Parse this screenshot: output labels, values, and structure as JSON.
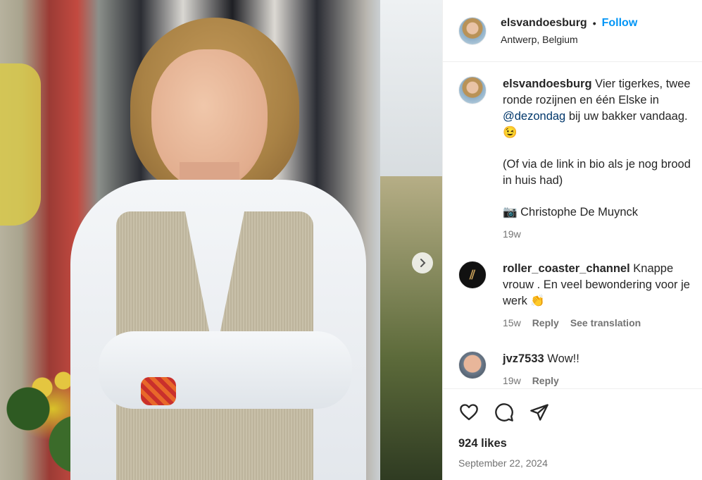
{
  "post": {
    "username": "elsvandoesburg",
    "separator": "•",
    "follow_label": "Follow",
    "location": "Antwerp, Belgium"
  },
  "caption": {
    "username": "elsvandoesburg",
    "text_before_mention": " Vier tigerkes, twee ronde rozijnen en één Elske in ",
    "mention": "@dezondag",
    "text_after_mention": " bij uw bakker vandaag. 😉",
    "paragraph2": "(Of via de link in bio als je nog brood in huis had)",
    "paragraph3": "📷 Christophe De Muynck",
    "time": "19w"
  },
  "comments": [
    {
      "username": "roller_coaster_channel",
      "text": " Knappe vrouw . En veel bewondering voor je werk 👏",
      "time": "15w",
      "reply_label": "Reply",
      "translate_label": "See translation"
    },
    {
      "username": "jvz7533",
      "text": " Wow!!",
      "time": "19w",
      "reply_label": "Reply"
    }
  ],
  "actions": {
    "likes": "924 likes",
    "date": "September 22, 2024"
  },
  "icons": {
    "next": "chevron-right-icon",
    "like": "heart-icon",
    "comment": "comment-bubble-icon",
    "share": "paper-plane-icon"
  },
  "colors": {
    "accent": "#0095f6",
    "mention": "#00376b",
    "secondary_text": "#737373"
  }
}
